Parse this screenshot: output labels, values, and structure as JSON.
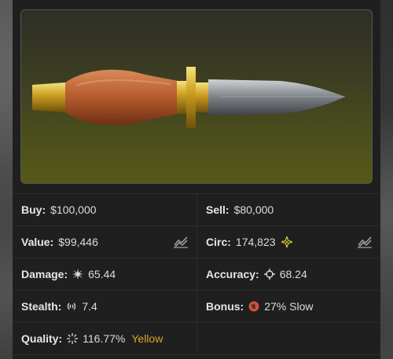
{
  "item": {
    "image_icon": "dagger-knife-image"
  },
  "stats": {
    "buy": {
      "label": "Buy:",
      "value": "$100,000"
    },
    "sell": {
      "label": "Sell:",
      "value": "$80,000"
    },
    "value": {
      "label": "Value:",
      "value": "$99,446",
      "icon": "trend-chart-icon"
    },
    "circ": {
      "label": "Circ:",
      "value": "174,823",
      "icon": "star-sparkle-icon",
      "trend_icon": "trend-chart-icon"
    },
    "damage": {
      "label": "Damage:",
      "value": "65.44",
      "icon": "burst-icon"
    },
    "accuracy": {
      "label": "Accuracy:",
      "value": "68.24",
      "icon": "crosshair-icon"
    },
    "stealth": {
      "label": "Stealth:",
      "value": "7.4",
      "icon": "sound-waves-icon"
    },
    "bonus": {
      "label": "Bonus:",
      "value": "27% Slow",
      "icon": "slow-bonus-icon"
    },
    "quality": {
      "label": "Quality:",
      "value": "116.77%",
      "tier": "Yellow",
      "icon": "sparkle-icon"
    }
  },
  "colors": {
    "quality_tier": "#d4a72c",
    "circ_star": "#c8c22a"
  }
}
